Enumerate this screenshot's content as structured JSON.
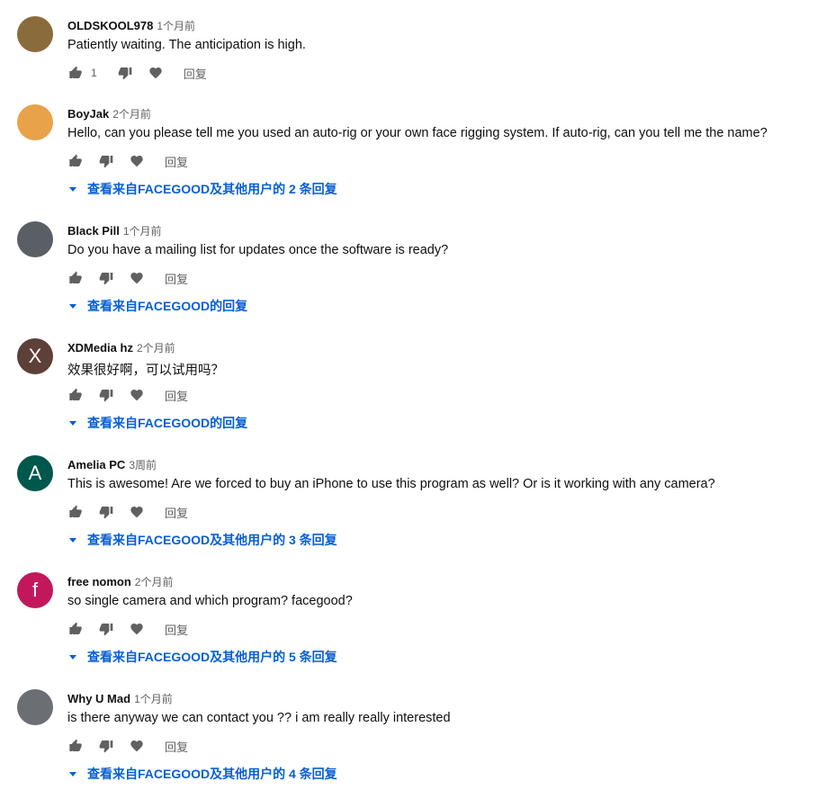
{
  "reply_label": "回复",
  "comments": [
    {
      "author": "OLDSKOOL978",
      "time": "1个月前",
      "text": "Patiently waiting. The anticipation is high.",
      "likes": "1",
      "avatar_letter": "",
      "avatar_color": "#8a6b3c",
      "replies_text": ""
    },
    {
      "author": "BoyJak",
      "time": "2个月前",
      "text": "Hello, can you please tell me you used an auto-rig or your own face rigging system. If auto-rig, can you tell me the name?",
      "likes": "",
      "avatar_letter": "",
      "avatar_color": "#e7a24a",
      "replies_text": "查看来自FACEGOOD及其他用户的 2 条回复"
    },
    {
      "author": "Black Pill",
      "time": "1个月前",
      "text": "Do you have a mailing list for updates once the software is ready?",
      "likes": "",
      "avatar_letter": "",
      "avatar_color": "#5a5f66",
      "replies_text": "查看来自FACEGOOD的回复"
    },
    {
      "author": "XDMedia hz",
      "time": "2个月前",
      "text": "效果很好啊，可以试用吗？",
      "likes": "",
      "avatar_letter": "X",
      "avatar_color": "#5d4037",
      "replies_text": "查看来自FACEGOOD的回复"
    },
    {
      "author": "Amelia PC",
      "time": "3周前",
      "text": "This is awesome! Are we forced to buy an iPhone to use this program as well? Or is it working with any camera?",
      "likes": "",
      "avatar_letter": "A",
      "avatar_color": "#00574b",
      "replies_text": "查看来自FACEGOOD及其他用户的 3 条回复"
    },
    {
      "author": "free nomon",
      "time": "2个月前",
      "text": "so single camera and which program? facegood?",
      "likes": "",
      "avatar_letter": "f",
      "avatar_color": "#c2185b",
      "replies_text": "查看来自FACEGOOD及其他用户的 5 条回复"
    },
    {
      "author": "Why U Mad",
      "time": "1个月前",
      "text": "is there anyway we can contact you ?? i am really really interested",
      "likes": "",
      "avatar_letter": "",
      "avatar_color": "#6b6f73",
      "replies_text": "查看来自FACEGOOD及其他用户的 4 条回复"
    }
  ]
}
